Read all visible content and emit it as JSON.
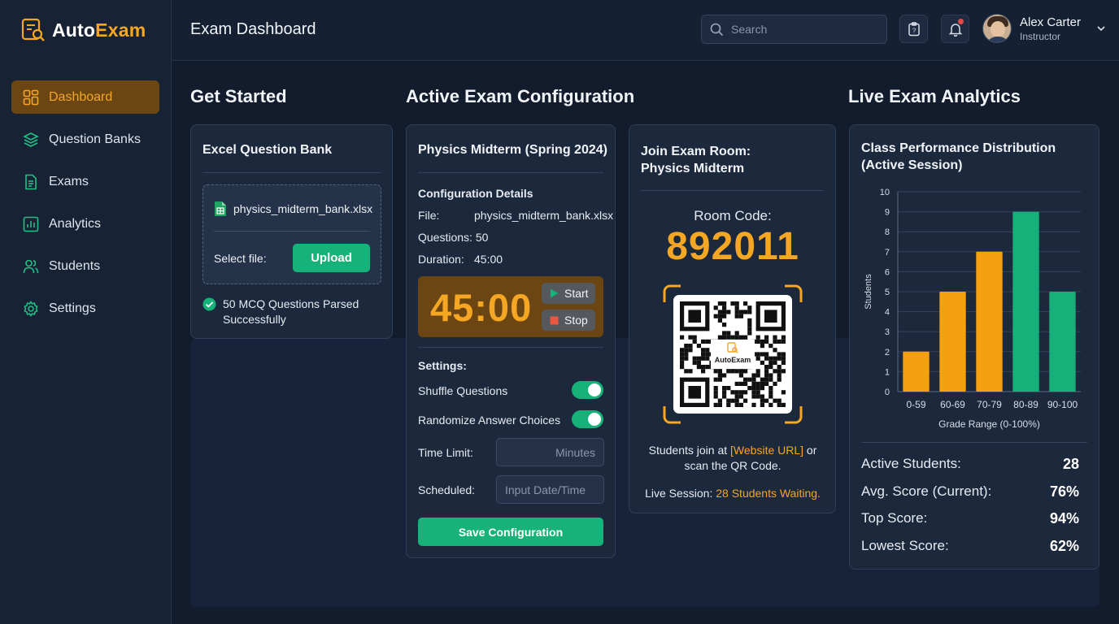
{
  "app": {
    "logo_part1": "Auto",
    "logo_part2": "Exam",
    "brand_color": "#f5a623",
    "accent_green": "#17b27a"
  },
  "sidebar": {
    "items": [
      {
        "label": "Dashboard",
        "icon": "dashboard-grid-icon",
        "active": true
      },
      {
        "label": "Question Banks",
        "icon": "layers-icon"
      },
      {
        "label": "Exams",
        "icon": "document-icon"
      },
      {
        "label": "Analytics",
        "icon": "bar-chart-icon"
      },
      {
        "label": "Students",
        "icon": "users-icon"
      },
      {
        "label": "Settings",
        "icon": "gear-icon"
      }
    ]
  },
  "header": {
    "title": "Exam Dashboard",
    "search_placeholder": "Search",
    "user_name": "Alex Carter",
    "user_role": "Instructor",
    "has_notification": true
  },
  "sections": {
    "get_started": "Get Started",
    "config": "Active Exam Configuration",
    "analytics": "Live Exam Analytics"
  },
  "excel": {
    "title": "Excel Question Bank",
    "file_name": "physics_midterm_bank.xlsx",
    "select_label": "Select file:",
    "upload_label": "Upload",
    "status_line1": "50 MCQ Questions Parsed",
    "status_line2": "Successfully"
  },
  "config": {
    "title": "Physics Midterm (Spring 2024)",
    "details_heading": "Configuration Details",
    "file_label": "File:",
    "file_value": "physics_midterm_bank.xlsx",
    "questions_text": "Questions: 50",
    "duration_label": "Duration:",
    "duration_value": "45:00",
    "timer": "45:00",
    "start_label": "Start",
    "stop_label": "Stop",
    "settings_heading": "Settings:",
    "shuffle_label": "Shuffle Questions",
    "shuffle_on": true,
    "randomize_label": "Randomize Answer Choices",
    "randomize_on": true,
    "time_limit_label": "Time Limit:",
    "time_limit_placeholder": "Minutes",
    "scheduled_label": "Scheduled:",
    "scheduled_placeholder": "Input Date/Time",
    "save_label": "Save Configuration"
  },
  "room": {
    "title_line1": "Join Exam Room:",
    "title_line2": "Physics Midterm",
    "code_label": "Room Code:",
    "code": "892011",
    "qr_brand": "AutoExam",
    "join_prefix": "Students join at ",
    "join_link": "[Website URL]",
    "join_suffix": " or",
    "join_line2": "scan the QR Code.",
    "live_prefix": "Live Session: ",
    "live_value": "28 Students Waiting."
  },
  "analytics": {
    "chart_title_line1": "Class Performance Distribution",
    "chart_title_line2": "(Active Session)",
    "stats": [
      {
        "label": "Active Students:",
        "value": "28"
      },
      {
        "label": "Avg. Score (Current):",
        "value": "76%"
      },
      {
        "label": "Top Score:",
        "value": "94%"
      },
      {
        "label": "Lowest Score:",
        "value": "62%"
      }
    ]
  },
  "chart_data": {
    "type": "bar",
    "title": "Class Performance Distribution (Active Session)",
    "xlabel": "Grade Range (0-100%)",
    "ylabel": "Students",
    "categories": [
      "0-59",
      "60-69",
      "70-79",
      "80-89",
      "90-100"
    ],
    "values": [
      2,
      5,
      7,
      9,
      5
    ],
    "colors": [
      "#f5a00f",
      "#f5a00f",
      "#f5a00f",
      "#16b07b",
      "#16b07b"
    ],
    "ylim": [
      0,
      10
    ],
    "yticks": [
      "0",
      "1",
      "2",
      "3",
      "4",
      "5",
      "6",
      "7",
      "8",
      "9",
      "10"
    ],
    "grid": true,
    "legend": "none"
  }
}
